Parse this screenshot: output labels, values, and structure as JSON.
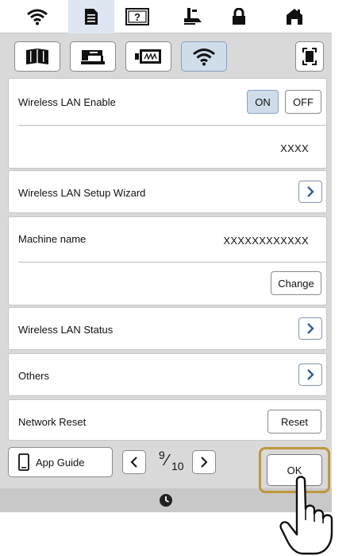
{
  "topbar": {
    "tabs": [
      {
        "icon": "wifi-icon"
      },
      {
        "icon": "document-icon",
        "active": true
      },
      {
        "icon": "help-screen-icon"
      },
      {
        "icon": "presser-foot-icon"
      },
      {
        "icon": "lock-icon"
      },
      {
        "icon": "home-icon"
      }
    ]
  },
  "categories": [
    {
      "icon": "book-icon"
    },
    {
      "icon": "sewing-machine-icon"
    },
    {
      "icon": "embroidery-frame-icon"
    },
    {
      "icon": "wifi-icon",
      "active": true
    }
  ],
  "wireless_enable": {
    "label": "Wireless LAN Enable",
    "on_label": "ON",
    "off_label": "OFF",
    "state": "ON",
    "network_value": "XXXX"
  },
  "setup_wizard": {
    "label": "Wireless LAN Setup Wizard"
  },
  "machine_name": {
    "label": "Machine name",
    "value": "XXXXXXXXXXXX",
    "change_label": "Change"
  },
  "status": {
    "label": "Wireless LAN Status"
  },
  "others": {
    "label": "Others"
  },
  "network_reset": {
    "label": "Network Reset",
    "reset_label": "Reset"
  },
  "bottom": {
    "app_guide_label": "App Guide",
    "page_current": "9",
    "page_total": "10",
    "ok_label": "OK"
  },
  "colors": {
    "accent_active": "#cfdcea",
    "highlight": "#c0963a",
    "arrow_blue": "#2f5f9e"
  }
}
